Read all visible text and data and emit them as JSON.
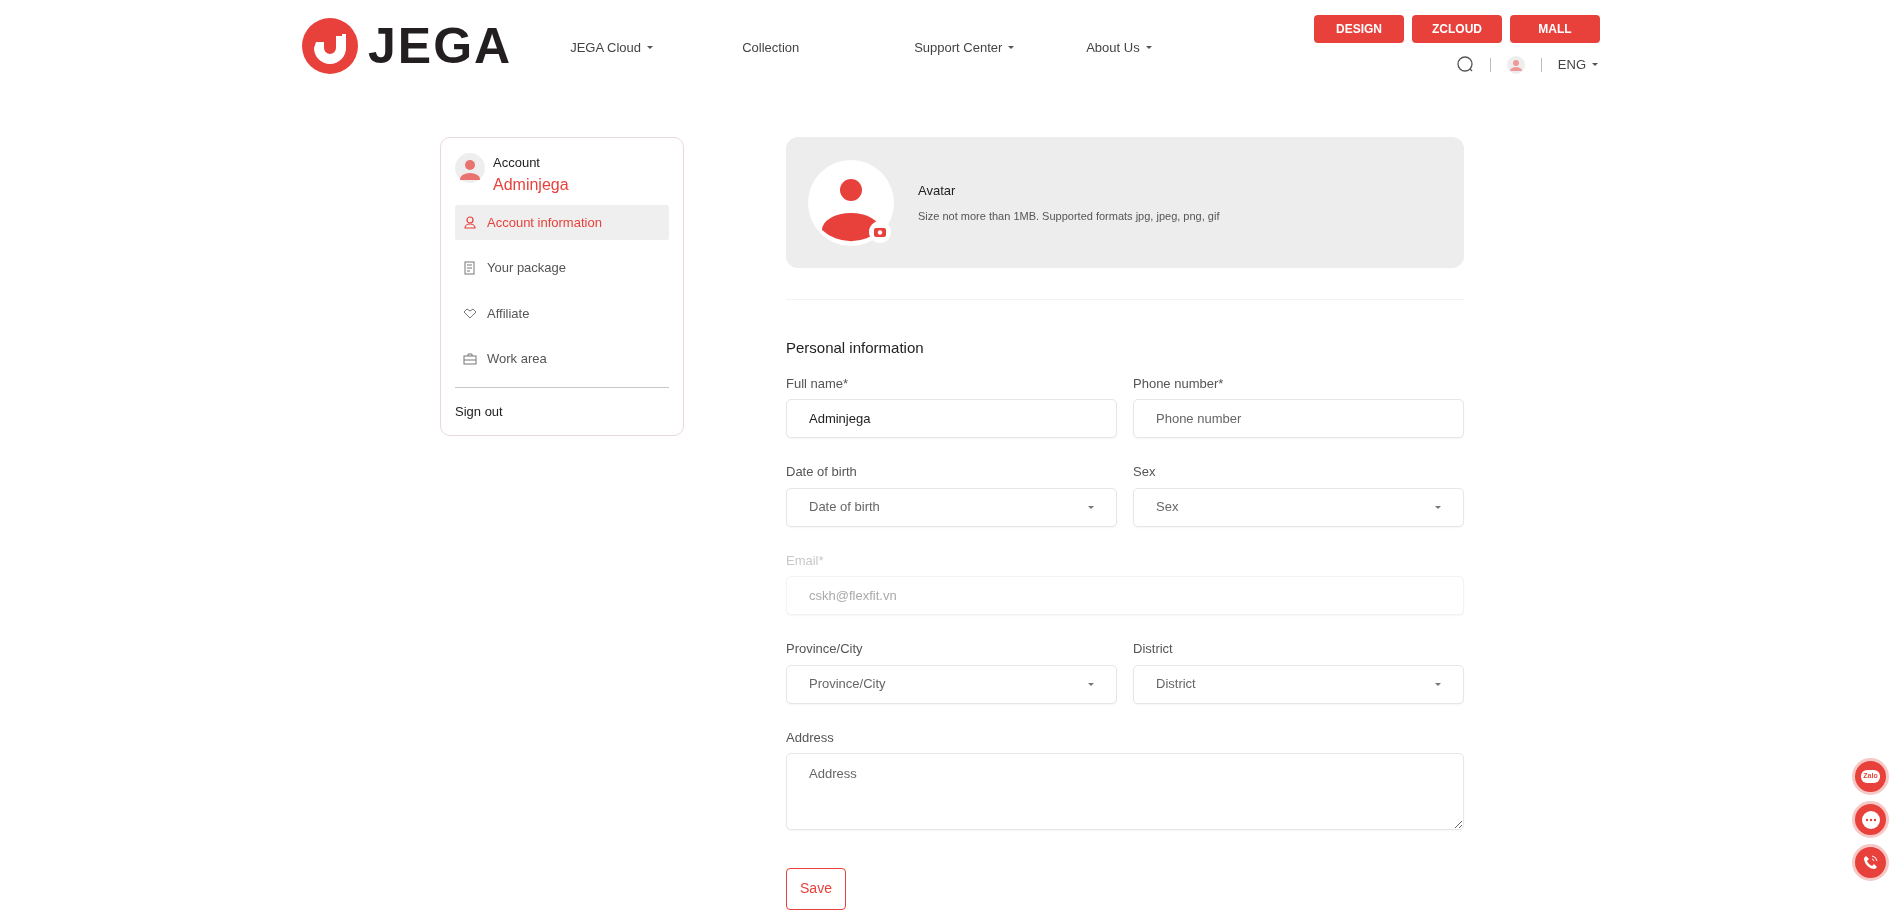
{
  "header": {
    "logo_text": "JEGA",
    "nav": [
      {
        "label": "JEGA Cloud",
        "dropdown": true
      },
      {
        "label": "Collection",
        "dropdown": false
      },
      {
        "label": "Support Center",
        "dropdown": true
      },
      {
        "label": "About Us",
        "dropdown": true
      }
    ],
    "buttons": [
      "DESIGN",
      "ZCLOUD",
      "MALL"
    ],
    "language": "ENG"
  },
  "sidebar": {
    "account_label": "Account",
    "username": "Adminjega",
    "items": [
      {
        "label": "Account information",
        "selected": true
      },
      {
        "label": "Your package",
        "selected": false
      },
      {
        "label": "Affiliate",
        "selected": false
      },
      {
        "label": "Work area",
        "selected": false
      }
    ],
    "sign_out": "Sign out"
  },
  "avatar": {
    "title": "Avatar",
    "hint": "Size not more than 1MB. Supported formats jpg, jpeg, png, gif"
  },
  "form": {
    "title": "Personal information",
    "rows": [
      [
        {
          "kind": "text",
          "label": "Full name*",
          "value": "Adminjega",
          "disabled": false
        },
        {
          "kind": "text",
          "label": "Phone number*",
          "placeholder": "Phone number",
          "disabled": false
        }
      ],
      [
        {
          "kind": "select",
          "label": "Date of birth",
          "placeholder": "Date of birth",
          "disabled": false
        },
        {
          "kind": "select",
          "label": "Sex",
          "placeholder": "Sex",
          "disabled": false
        }
      ],
      [
        {
          "kind": "text",
          "label": "Email*",
          "placeholder": "cskh@flexfit.vn",
          "disabled": true
        }
      ],
      [
        {
          "kind": "select",
          "label": "Province/City",
          "placeholder": "Province/City",
          "disabled": false
        },
        {
          "kind": "select",
          "label": "District",
          "placeholder": "District",
          "disabled": false
        }
      ],
      [
        {
          "kind": "textarea",
          "label": "Address",
          "placeholder": "Address",
          "disabled": false
        }
      ]
    ],
    "save": "Save"
  },
  "floating": [
    {
      "kind": "zalo",
      "text": "Zalo"
    },
    {
      "kind": "chat"
    },
    {
      "kind": "phone"
    }
  ]
}
